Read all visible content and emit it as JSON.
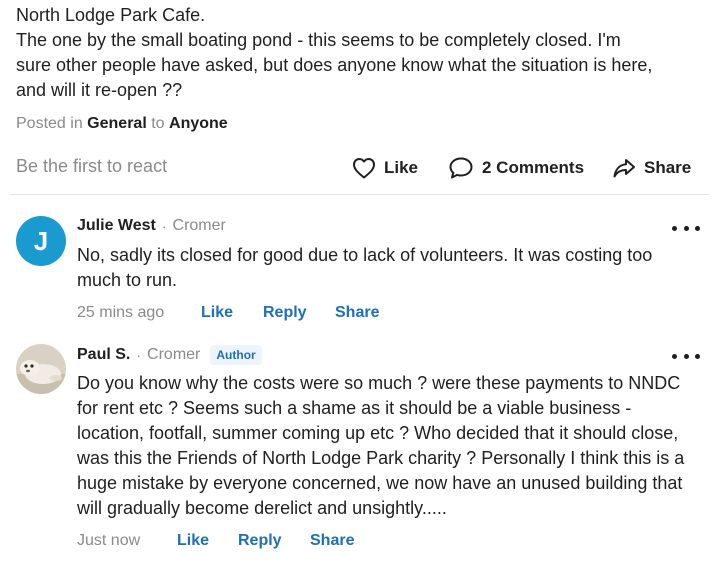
{
  "post": {
    "lines": [
      "North Lodge Park Cafe.",
      "The one by the small boating pond - this seems to be completely closed. I'm",
      "sure other people have asked, but does anyone know what the situation is here,",
      "and will it re-open ??"
    ],
    "posted_in_prefix": "Posted in",
    "category": "General",
    "to_word": "to",
    "audience": "Anyone"
  },
  "reactions": {
    "first_react": "Be the first to react",
    "like_label": "Like",
    "comments_label": "2 Comments",
    "share_label": "Share"
  },
  "comments": [
    {
      "avatar_letter": "J",
      "avatar_color": "#1a9bd0",
      "name": "Julie West",
      "separator": "·",
      "location": "Cromer",
      "badge": "",
      "lines": [
        "No, sadly its closed for good due to lack of volunteers.  It was costing too",
        "much to run."
      ],
      "time": "25 mins ago",
      "like": "Like",
      "reply": "Reply",
      "share": "Share"
    },
    {
      "avatar_letter": "",
      "avatar_color": "",
      "name": "Paul S.",
      "separator": "·",
      "location": "Cromer",
      "badge": "Author",
      "lines": [
        "Do you know why the costs were so much ? were these payments to NNDC",
        "for rent etc ?  Seems such a shame as it should be a viable business -",
        "location, footfall, summer coming up etc ?  Who decided that it should close,",
        "was this the Friends of North Lodge Park charity ? Personally I think this is a",
        "huge mistake by everyone concerned, we now have an unused building that",
        "will gradually become derelict and unsightly....."
      ],
      "time": "Just now",
      "like": "Like",
      "reply": "Reply",
      "share": "Share"
    }
  ],
  "colors": {
    "link": "#1d6fb8",
    "muted": "#8a8a8a",
    "text": "#1f1f1f"
  }
}
